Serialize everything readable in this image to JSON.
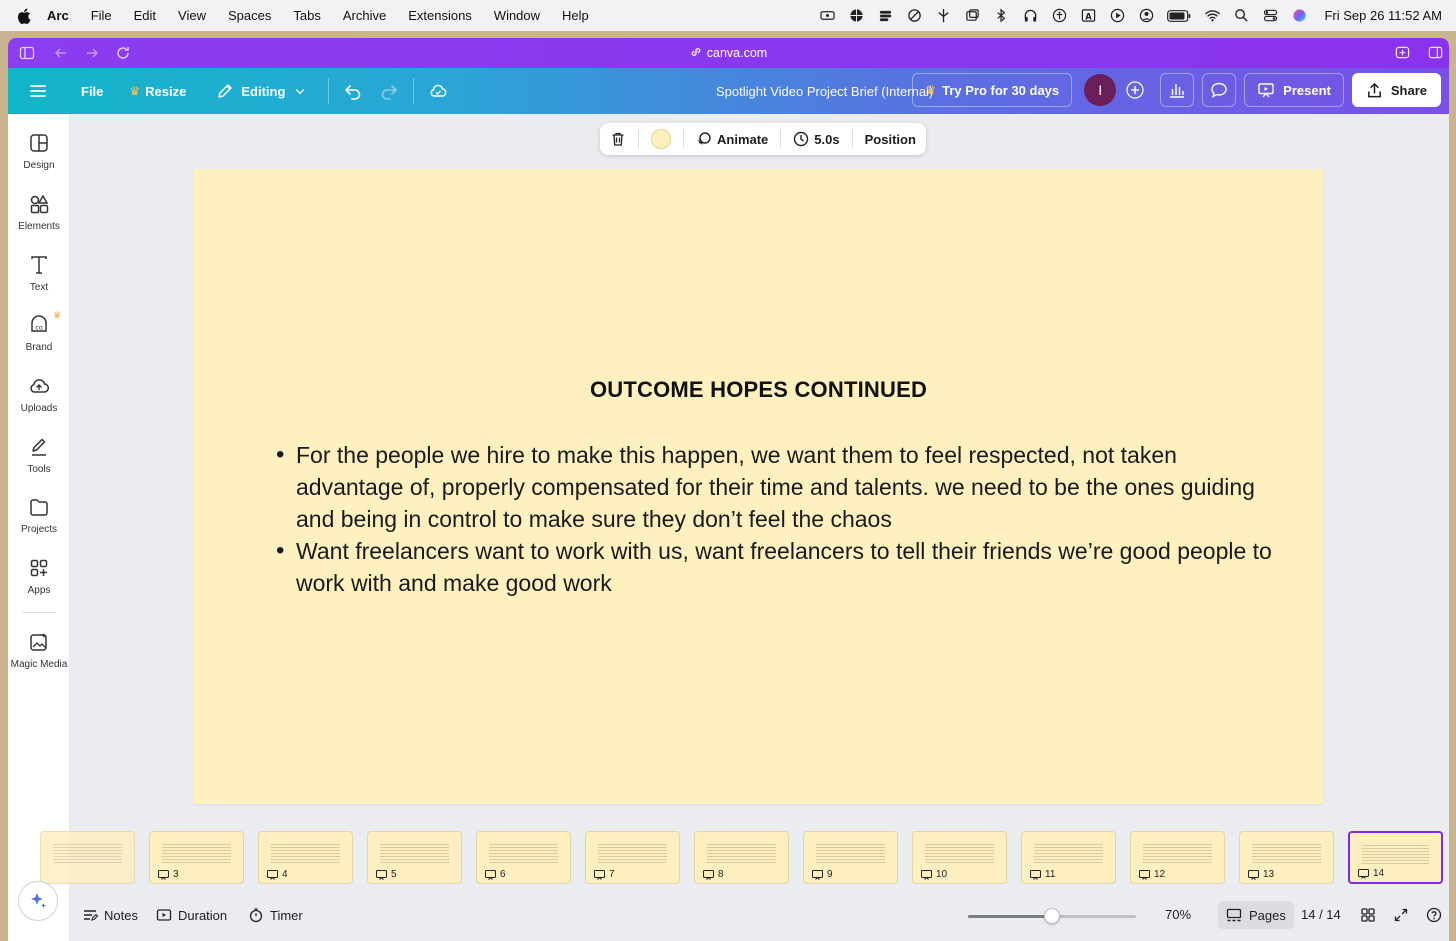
{
  "menubar": {
    "app": "Arc",
    "items": [
      "File",
      "Edit",
      "View",
      "Spaces",
      "Tabs",
      "Archive",
      "Extensions",
      "Window",
      "Help"
    ],
    "clock": "Fri Sep 26  11:52 AM",
    "status_icons": [
      "screen-mirror-icon",
      "basketball-icon",
      "stack-icon",
      "do-not-disturb-icon",
      "lightning-icon",
      "windows-icon",
      "bluetooth-icon",
      "headphones-icon",
      "accessibility-icon",
      "input-a-icon",
      "play-icon",
      "user-icon",
      "battery-icon",
      "wifi-icon",
      "search-icon",
      "control-center-icon",
      "siri-icon"
    ]
  },
  "browser": {
    "url": "canva.com"
  },
  "toolbar": {
    "file_label": "File",
    "resize_label": "Resize",
    "editing_label": "Editing",
    "doc_title": "Spotlight Video Project Brief (Internal)",
    "try_pro_label": "Try Pro for 30 days",
    "avatar_initial": "I",
    "present_label": "Present",
    "share_label": "Share",
    "accent": "#7d2ae8"
  },
  "sidebar": {
    "items": [
      {
        "label": "Design",
        "icon": "design-icon"
      },
      {
        "label": "Elements",
        "icon": "elements-icon"
      },
      {
        "label": "Text",
        "icon": "text-icon"
      },
      {
        "label": "Brand",
        "icon": "brand-icon"
      },
      {
        "label": "Uploads",
        "icon": "uploads-icon"
      },
      {
        "label": "Tools",
        "icon": "tools-icon"
      },
      {
        "label": "Projects",
        "icon": "projects-icon"
      },
      {
        "label": "Apps",
        "icon": "apps-icon"
      },
      {
        "label": "Magic Media",
        "icon": "magic-media-icon"
      }
    ]
  },
  "context_toolbar": {
    "animate_label": "Animate",
    "duration_label": "5.0s",
    "position_label": "Position",
    "swatch_color": "#fff1bb"
  },
  "slide": {
    "background": "#fff1bf",
    "title": "OUTCOME HOPES CONTINUED",
    "bullets": [
      "For the people we hire to make this happen, we want them to feel respected, not taken advantage of, properly compensated for their time and talents.  we need to be the ones guiding and being in control to make sure they don’t feel the chaos",
      "Want freelancers want to work with us, want freelancers to tell their friends we’re good people to work with and make good work"
    ]
  },
  "filmstrip": {
    "pages": [
      "3",
      "4",
      "5",
      "6",
      "7",
      "8",
      "9",
      "10",
      "11",
      "12",
      "13",
      "14"
    ],
    "active_page": "14"
  },
  "bottombar": {
    "notes_label": "Notes",
    "duration_label": "Duration",
    "timer_label": "Timer",
    "zoom_level": "70%",
    "zoom_fraction": 0.5,
    "pages_label": "Pages",
    "page_counter": "14 / 14"
  }
}
